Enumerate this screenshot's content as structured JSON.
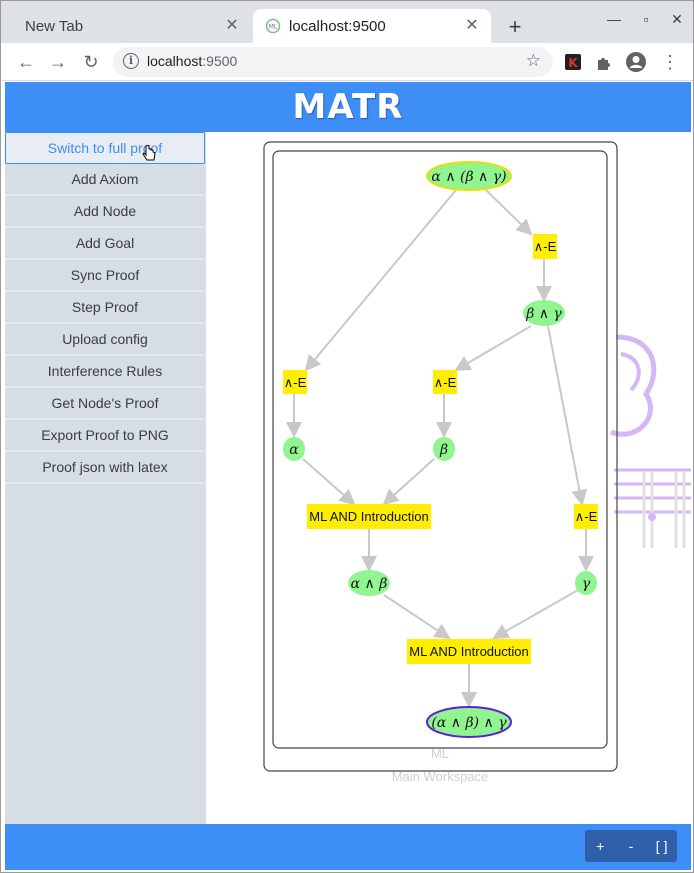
{
  "browser": {
    "tabs": [
      {
        "label": "New Tab",
        "active": false
      },
      {
        "label": "localhost:9500",
        "active": true
      }
    ],
    "url_host": "localhost",
    "url_port": ":9500"
  },
  "app": {
    "title": "MATR",
    "sidebar_buttons": [
      "Switch to full proof",
      "Add Axiom",
      "Add Node",
      "Add Goal",
      "Sync Proof",
      "Step Proof",
      "Upload config",
      "Interference Rules",
      "Get Node's Proof",
      "Export Proof to PNG",
      "Proof json with latex"
    ],
    "active_button_index": 0
  },
  "graph": {
    "cluster_inner_label": "ML",
    "cluster_outer_label": "Main Workspace",
    "nodes": {
      "top": "α ∧ (β ∧ γ)",
      "rule_and_e_1": "∧-E",
      "beta_and_gamma": "β ∧ γ",
      "rule_and_e_left": "∧-E",
      "rule_and_e_mid": "∧-E",
      "alpha": "α",
      "beta": "β",
      "ml_and_intro_1": "ML AND Introduction",
      "rule_and_e_right": "∧-E",
      "alpha_and_beta": "α ∧ β",
      "gamma": "γ",
      "ml_and_intro_2": "ML AND Introduction",
      "goal": "(α ∧ β) ∧ γ"
    },
    "colors": {
      "formula_fill": "#90f590",
      "rule_fill": "#ffee00",
      "top_stroke": "#e8e000",
      "goal_stroke": "#5b1fd6",
      "edge": "#c8c8c8"
    }
  },
  "zoom": {
    "plus": "+",
    "minus": "-",
    "fit": "[ ]"
  },
  "colors": {
    "accent": "#3e8ef7",
    "sidebar": "#d7dde5"
  }
}
